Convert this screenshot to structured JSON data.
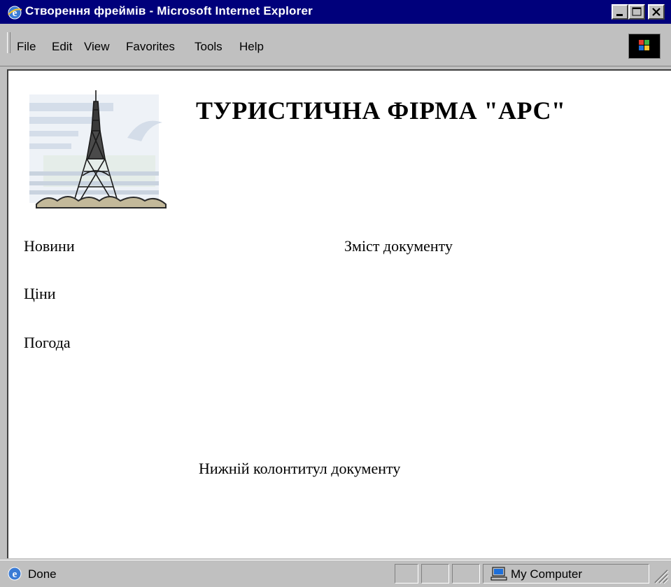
{
  "window": {
    "title": "Створення фреймів - Microsoft Internet Explorer"
  },
  "menu": {
    "file": "File",
    "edit": "Edit",
    "view": "View",
    "favorites": "Favorites",
    "tools": "Tools",
    "help": "Help"
  },
  "page": {
    "heading": "ТУРИСТИЧНА ФІРМА \"АРС\"",
    "nav": [
      "Новини",
      "Ціни",
      "Погода"
    ],
    "main_text": "Зміст документу",
    "footer_text": "Нижній колонтитул документу"
  },
  "status": {
    "text": "Done",
    "zone": "My Computer"
  },
  "icons": {
    "app": "ie-logo-icon",
    "throbber": "windows-logo-icon",
    "zone": "computer-icon",
    "picture": "eiffel-tower-image"
  },
  "colors": {
    "titlebar": "#00007b",
    "chrome": "#c0c0c0"
  }
}
